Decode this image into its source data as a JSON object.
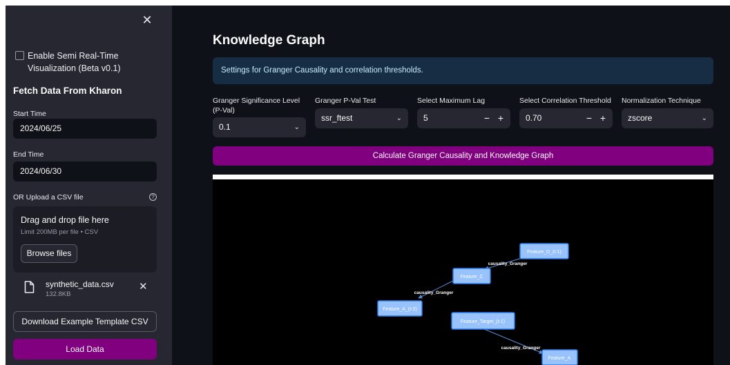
{
  "sidebar": {
    "close_icon": "close-icon",
    "semi_realtime_label": "Enable Semi Real-Time Visualization (Beta v0.1)",
    "fetch_title": "Fetch Data From Kharon",
    "start_time_label": "Start Time",
    "start_time_value": "2024/06/25",
    "end_time_label": "End Time",
    "end_time_value": "2024/06/30",
    "upload_label": "OR Upload a CSV file",
    "help_icon": "?",
    "dropzone": {
      "title": "Drag and drop file here",
      "subtitle": "Limit 200MB per file • CSV",
      "browse_label": "Browse files"
    },
    "file": {
      "name": "synthetic_data.csv",
      "size": "132.8KB",
      "remove_icon": "✕"
    },
    "download_template_label": "Download Example Template CSV",
    "load_data_label": "Load Data"
  },
  "main": {
    "title": "Knowledge Graph",
    "info_text": "Settings for Granger Causality and correlation thresholds.",
    "controls": {
      "significance": {
        "label": "Granger Significance Level (P-Val)",
        "value": "0.1"
      },
      "pval_test": {
        "label": "Granger P-Val Test",
        "value": "ssr_ftest"
      },
      "max_lag": {
        "label": "Select Maximum Lag",
        "value": "5"
      },
      "corr_threshold": {
        "label": "Select Correlation Threshold",
        "value": "0.70"
      },
      "normalization": {
        "label": "Normalization Technique",
        "value": "zscore"
      }
    },
    "stepper": {
      "minus": "−",
      "plus": "+"
    },
    "chevron": "⌄",
    "calculate_label": "Calculate Granger Causality and Knowledge Graph"
  },
  "graph": {
    "nodes": {
      "feature_d": "Feature_D_(t-1)",
      "feature_c": "Feature_C",
      "feature_a_t2": "Feature_A_(t-2)",
      "feature_target": "Feature_Target_(t-1)",
      "feature_a": "Feature_A"
    },
    "edges": {
      "d_to_c": "causality_Granger",
      "c_to_a2": "causality_Granger",
      "target_to_a": "causality_Granger"
    }
  },
  "colors": {
    "sidebar_bg": "#262730",
    "main_bg": "#0e1117",
    "accent": "#800080",
    "info_bg": "#172d43",
    "info_text": "#c7ebff",
    "node_fill": "#97c2fc",
    "node_border": "#2b7ce9"
  }
}
